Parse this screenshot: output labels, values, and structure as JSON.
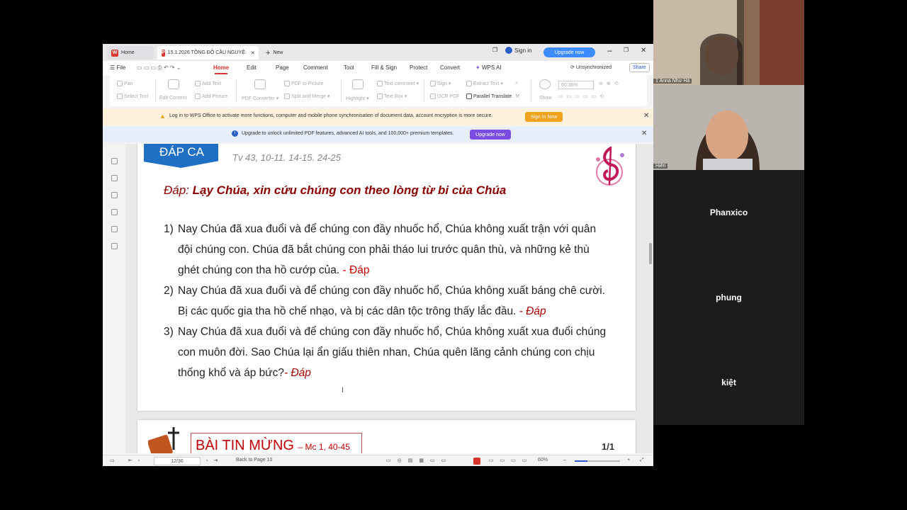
{
  "window": {
    "tabs": [
      {
        "label": "Home"
      },
      {
        "label": "15.1.2026 TỒNG ĐỒ CẦU NGUYỆ"
      },
      {
        "label": "New"
      }
    ],
    "sign_in": "Sign in",
    "upgrade_now": "Upgrade now"
  },
  "menu": {
    "file": "File",
    "items": [
      "Home",
      "Edit",
      "Page",
      "Comment",
      "Tool",
      "Fill & Sign",
      "Protect",
      "Convert",
      "WPS AI"
    ],
    "unsynchronized": "Unsynchronized",
    "share": "Share"
  },
  "toolbar": {
    "pan": "Pan",
    "select_tool": "Select Tool",
    "edit_content": "Edit Content",
    "add_text": "Add Text",
    "add_picture": "Add Picture",
    "pdf_converter": "PDF Converter",
    "pdf_to_picture": "PDF to Picture",
    "split_merge": "Split and Merge",
    "highlight": "Highlight",
    "text_comment": "Text comment",
    "text_box": "Text Box",
    "sign": "Sign",
    "ocr_pdf": "OCR PDF",
    "extract_text": "Extract Text",
    "parallel_translate": "Parallel Translate",
    "show": "Show",
    "zoom": "60.36%"
  },
  "notices": {
    "login_text": "Log in to WPS Office to activate more functions, computer and mobile phone synchronisation of document data, account encryption is more secure.",
    "login_button": "Sign In Now",
    "upgrade_text": "Upgrade to unlock unlimited PDF features, advanced AI tools, and 100,000+ premium templates.",
    "upgrade_button": "Upgrade now"
  },
  "document": {
    "banner": "ĐÁP CA",
    "psalm_ref": "Tv 43, 10-11. 14-15. 24-25",
    "response_label": "Đáp:",
    "response_text": "Lạy Chúa, xin cứu chúng con theo lòng từ bi của Chúa",
    "verses": [
      {
        "num": "1)",
        "text": "Nay Chúa đã xua đuổi và để chúng con đầy nhuốc hổ, Chúa không xuất trận với quân đội chúng con. Chúa đã bắt chúng con phải tháo lui trước quân thù, và những kẻ thù ghét chúng con tha hồ cướp của.",
        "tail": " - Đáp"
      },
      {
        "num": "2)",
        "text": "Nay Chúa đã xua đuổi và để chúng con đầy nhuốc hổ, Chúa không xuất báng chê cười. Bị các quốc gia tha hồ chế nhạo, và bị các dân tộc trông thấy lắc đầu.",
        "tail": " - Đáp"
      },
      {
        "num": "3)",
        "text": "Nay Chúa đã xua đuổi và để chúng con đầy nhuốc hổ, Chúa không xuất xua đuổi chúng con muôn đời. Sao Chúa lại ẩn giấu thiên nhan, Chúa quên lãng cảnh chúng con chịu thống khổ và áp bức?",
        "tail": "- Đáp"
      }
    ],
    "gospel_title": "BÀI TIN MỪNG",
    "gospel_ref": "– Mc 1, 40-45",
    "page_indicator": "1/1"
  },
  "status": {
    "page": "12/36",
    "back_to_page": "Back to Page 10",
    "zoom": "60%"
  },
  "participants": {
    "video": [
      {
        "name": "1 Anna Như Hà"
      },
      {
        "name": "Hiền"
      }
    ],
    "names_only": [
      "Phanxico",
      "phung",
      "kiệt"
    ]
  }
}
